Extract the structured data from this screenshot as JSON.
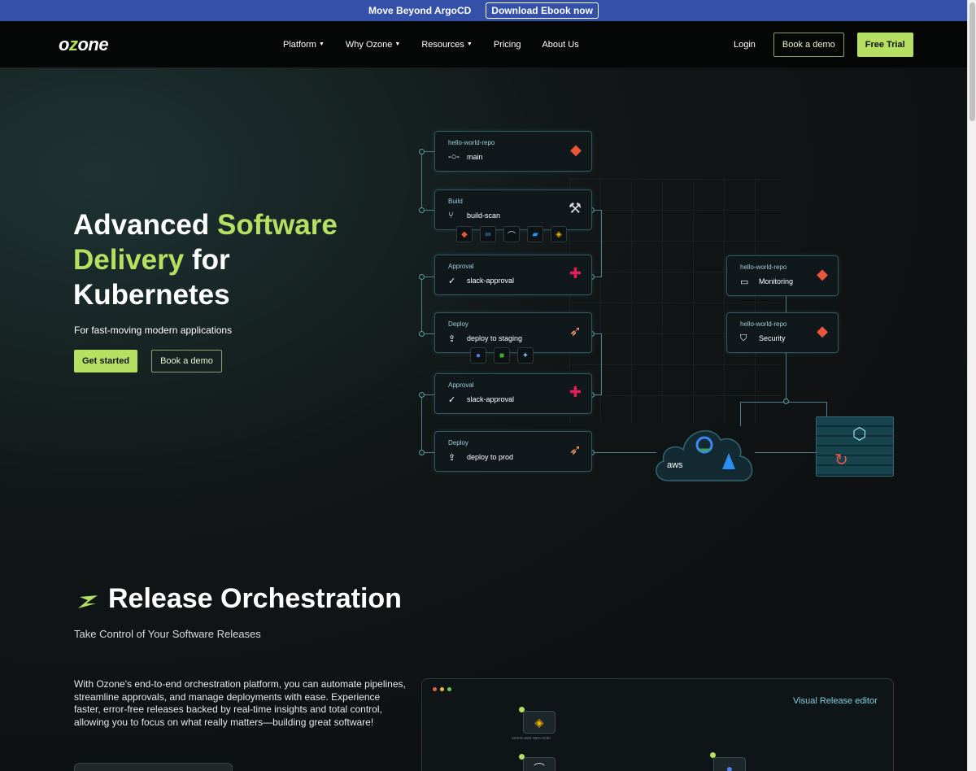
{
  "announcement": {
    "text": "Move Beyond ArgoCD",
    "button_label": "Download Ebook now"
  },
  "nav": {
    "logo_prefix": "o",
    "logo_accent": "z",
    "logo_suffix": "one",
    "links": [
      {
        "label": "Platform",
        "dropdown": true
      },
      {
        "label": "Why Ozone",
        "dropdown": true
      },
      {
        "label": "Resources",
        "dropdown": true
      },
      {
        "label": "Pricing",
        "dropdown": false
      },
      {
        "label": "About Us",
        "dropdown": false
      }
    ],
    "login": "Login",
    "book_demo": "Book a demo",
    "free_trial": "Free Trial"
  },
  "hero": {
    "title_1": "Advanced ",
    "title_2": "Software Delivery",
    "title_3": " for Kubernetes",
    "subtitle": "For fast-moving modern applications",
    "get_started": "Get started",
    "book_demo": "Book a demo"
  },
  "diagram": {
    "cards": [
      {
        "category": "hello-world-repo",
        "label": "main",
        "icon": "commit-icon",
        "right_icon": "git-icon"
      },
      {
        "category": "Build",
        "label": "build-scan",
        "icon": "branch-icon",
        "right_icon": "tools-icon"
      },
      {
        "category": "Approval",
        "label": "slack-approval",
        "icon": "check-circle-icon",
        "right_icon": "slack-icon"
      },
      {
        "category": "Deploy",
        "label": "deploy to staging",
        "icon": "upload-icon",
        "right_icon": "rocket-icon"
      },
      {
        "category": "Approval",
        "label": "slack-approval",
        "icon": "check-circle-icon",
        "right_icon": "slack-icon"
      },
      {
        "category": "Deploy",
        "label": "deploy to prod",
        "icon": "upload-icon",
        "right_icon": "rocket-icon"
      }
    ],
    "side_cards": [
      {
        "category": "hello-world-repo",
        "label": "Monitoring",
        "icon": "monitor-icon",
        "right_icon": "git-icon"
      },
      {
        "category": "hello-world-repo",
        "label": "Security",
        "icon": "shield-icon",
        "right_icon": "git-icon"
      }
    ],
    "cloud_label": "aws"
  },
  "release": {
    "title": "Release Orchestration",
    "subtitle": "Take Control of Your Software Releases",
    "body": "With Ozone's end-to-end orchestration platform, you can automate pipelines, streamline approvals, and manage deployments with ease. Experience faster, error-free releases backed by real-time insights and total control, allowing you to focus on what really matters—building great software!",
    "editor_title": "Visual Release editor",
    "editor_node_label": "ozone-aws-repo-scan"
  },
  "colors": {
    "accent_green": "#b5e061",
    "announce_blue": "#3550a8",
    "card_border": "#2f5760"
  }
}
